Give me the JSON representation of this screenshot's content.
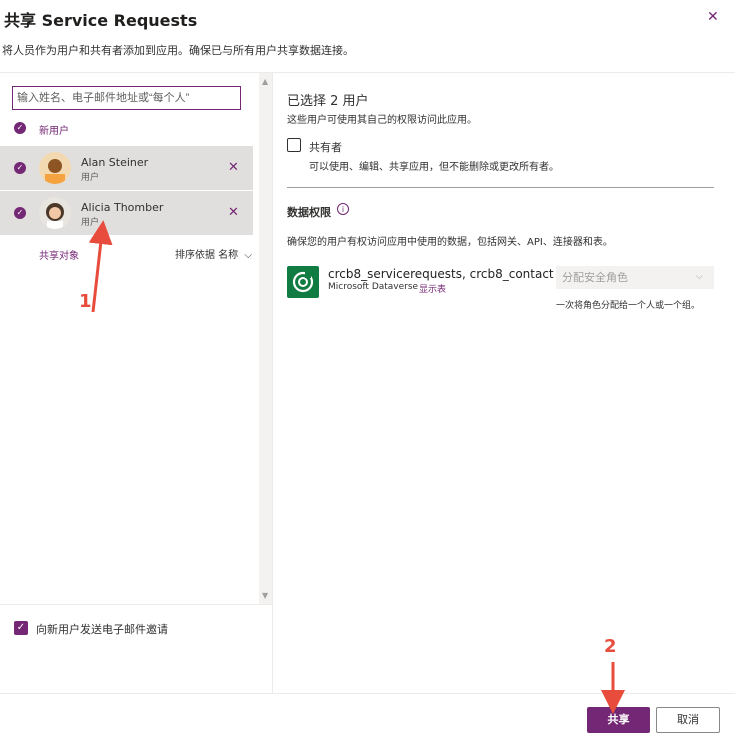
{
  "header": {
    "title": "共享 Service Requests",
    "subtitle": "将人员作为用户和共有者添加到应用。确保已与所有用户共享数据连接。"
  },
  "left": {
    "search_placeholder": "输入姓名、电子邮件地址或“每个人”",
    "new_user_label": "新用户",
    "users": [
      {
        "name": "Alan Steiner",
        "role": "用户"
      },
      {
        "name": "Alicia Thomber",
        "role": "用户"
      }
    ],
    "shared_with": "共享对象",
    "sort_by": "排序依据 名称",
    "email_invite": "向新用户发送电子邮件邀请"
  },
  "right": {
    "selected_count": "已选择 2 用户",
    "selected_desc": "这些用户可使用其自己的权限访问此应用。",
    "co_owner_label": "共有者",
    "co_owner_desc": "可以使用、编辑、共享应用，但不能删除或更改所有者。",
    "perm_title": "数据权限",
    "perm_desc": "确保您的用户有权访问应用中使用的数据，包括网关、API、连接器和表。",
    "table_name": "crcb8_servicerequests, crcb8_contact",
    "source": "Microsoft Dataverse",
    "show_table": "显示表",
    "role_placeholder": "分配安全角色",
    "role_hint": "一次将角色分配给一个人或一个组。"
  },
  "footer": {
    "share": "共享",
    "cancel": "取消"
  },
  "annotations": [
    "1",
    "2"
  ],
  "colors": {
    "accent": "#742774",
    "arrow": "#e74c3c",
    "dataverse": "#107c41"
  }
}
